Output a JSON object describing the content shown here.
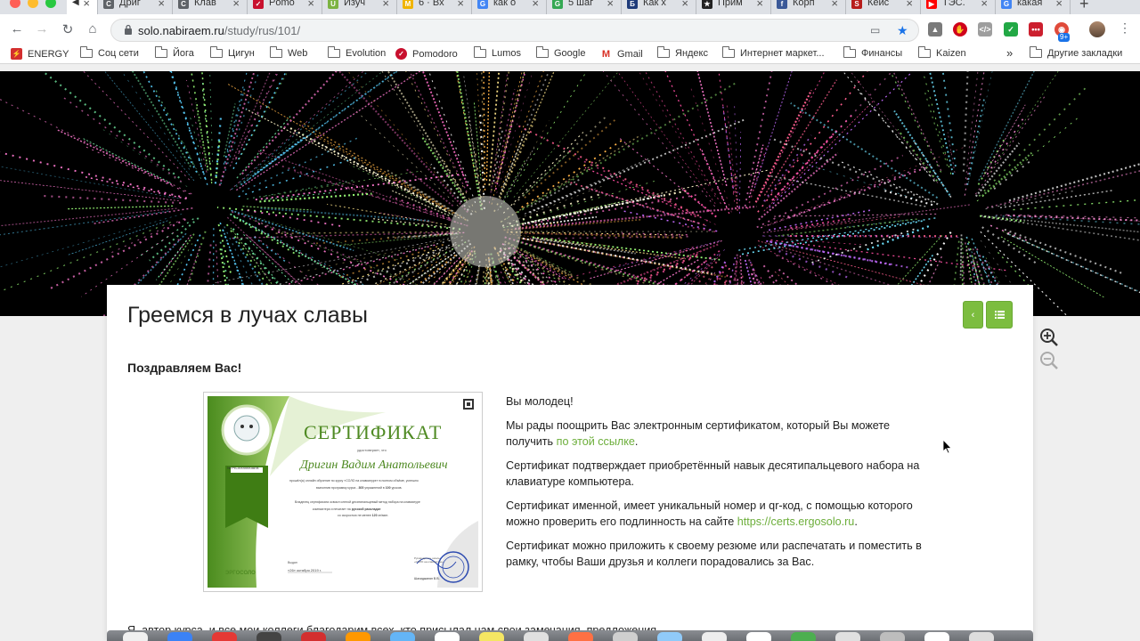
{
  "tabs": [
    {
      "label": "Дриг",
      "fav": "С",
      "color": "#5f6368"
    },
    {
      "label": "Клав",
      "fav": "С",
      "color": "#5f6368"
    },
    {
      "label": "Pomo",
      "fav": "✓",
      "color": "#c8102e"
    },
    {
      "label": "Изуч",
      "fav": "U",
      "color": "#7cb342"
    },
    {
      "label": "6 · Вх",
      "fav": "M",
      "color": "#f0b400"
    },
    {
      "label": "как о",
      "fav": "G",
      "color": "#4285f4"
    },
    {
      "label": "5 шаг",
      "fav": "G",
      "color": "#34a853"
    },
    {
      "label": "Как х",
      "fav": "Б",
      "color": "#1f3b7a"
    },
    {
      "label": "Прим",
      "fav": "★",
      "color": "#222222"
    },
    {
      "label": "Корп",
      "fav": "f",
      "color": "#3b5998"
    },
    {
      "label": "Кейс",
      "fav": "S",
      "color": "#b71c1c"
    },
    {
      "label": "ТЭС.",
      "fav": "▶",
      "color": "#ff0000"
    },
    {
      "label": "какая",
      "fav": "G",
      "color": "#4285f4"
    }
  ],
  "address": {
    "host": "solo.nabiraem.ru",
    "path": "/study/rus/101/"
  },
  "extensions_badge": "9+",
  "bookmarks": [
    {
      "label": "ENERGY",
      "kind": "energy"
    },
    {
      "label": "Соц сети",
      "kind": "folder"
    },
    {
      "label": "Йога",
      "kind": "folder"
    },
    {
      "label": "Цигун",
      "kind": "folder"
    },
    {
      "label": "Web",
      "kind": "folder"
    },
    {
      "label": "Evolution",
      "kind": "folder"
    },
    {
      "label": "Pomodoro",
      "kind": "pomodoro"
    },
    {
      "label": "Lumos",
      "kind": "folder"
    },
    {
      "label": "Google",
      "kind": "folder"
    },
    {
      "label": "Gmail",
      "kind": "gmail"
    },
    {
      "label": "Яндекс",
      "kind": "folder"
    },
    {
      "label": "Интернет маркет...",
      "kind": "folder"
    },
    {
      "label": "Финансы",
      "kind": "folder"
    },
    {
      "label": "Kaizen",
      "kind": "folder"
    }
  ],
  "bookmarks_more": "»",
  "other_bookmarks": "Другие закладки",
  "page": {
    "title": "Греемся в лучах славы",
    "back_btn": "‹",
    "list_btn": "≡",
    "congrats": "Поздравляем Вас!",
    "p1": "Вы молодец!",
    "p2_a": "Мы рады поощрить Вас электронным сертификатом, который Вы можете получить ",
    "p2_link": "по этой ссылке",
    "p2_b": ".",
    "p3": "Сертификат подтверждает приобретённый навык десятипальцевого набора на клавиатуре компьютера.",
    "p4_a": "Сертификат именной, имеет уникальный номер и qr-код, с помощью которого можно проверить его подлинность на сайте ",
    "p4_link": "https://certs.ergosolo.ru",
    "p4_b": ".",
    "p5": "Сертификат можно приложить к своему резюме или распечатать и поместить в рамку, чтобы Ваши друзья и коллеги порадовались за Вас.",
    "cut_line": "Я, автор курса, и все мои коллеги благодарим всех, кто присылал нам свои замечания, предложения"
  },
  "certificate": {
    "heading": "СЕРТИФИКАТ",
    "sub": "удостоверяет, что",
    "name": "Дригин Вадим Анатольевич",
    "number": "№ РБ-0000000АЕВ",
    "line1": "прошёл(а) онлайн обучение по курсу «СОЛО на клавиатуре» в полном объёме, успешно",
    "line2_a": "выполнив программу курса -",
    "exercises": "305",
    "line2_b": "упражнений в",
    "lessons": "100",
    "line2_c": "уроков.",
    "line3": "Владелец сертификата освоил слепой десятипальцевый метод набора на клавиатуре",
    "line4_a": "компьютера и печатает на",
    "layout": "русской раскладке",
    "line5_a": "со скоростью не менее",
    "speed": "120",
    "line5_b": "зн/мин.",
    "date_label": "Выдан",
    "date": "«26» октября 2019 г.",
    "signer_label": "Руководитель школы «СОЛО на клавиатуре»",
    "signer": "Шахиджанян В.В.",
    "brand": "ЭРГОСОЛО"
  },
  "colors": {
    "accent": "#7cbd3f",
    "link": "#6cae3a"
  }
}
